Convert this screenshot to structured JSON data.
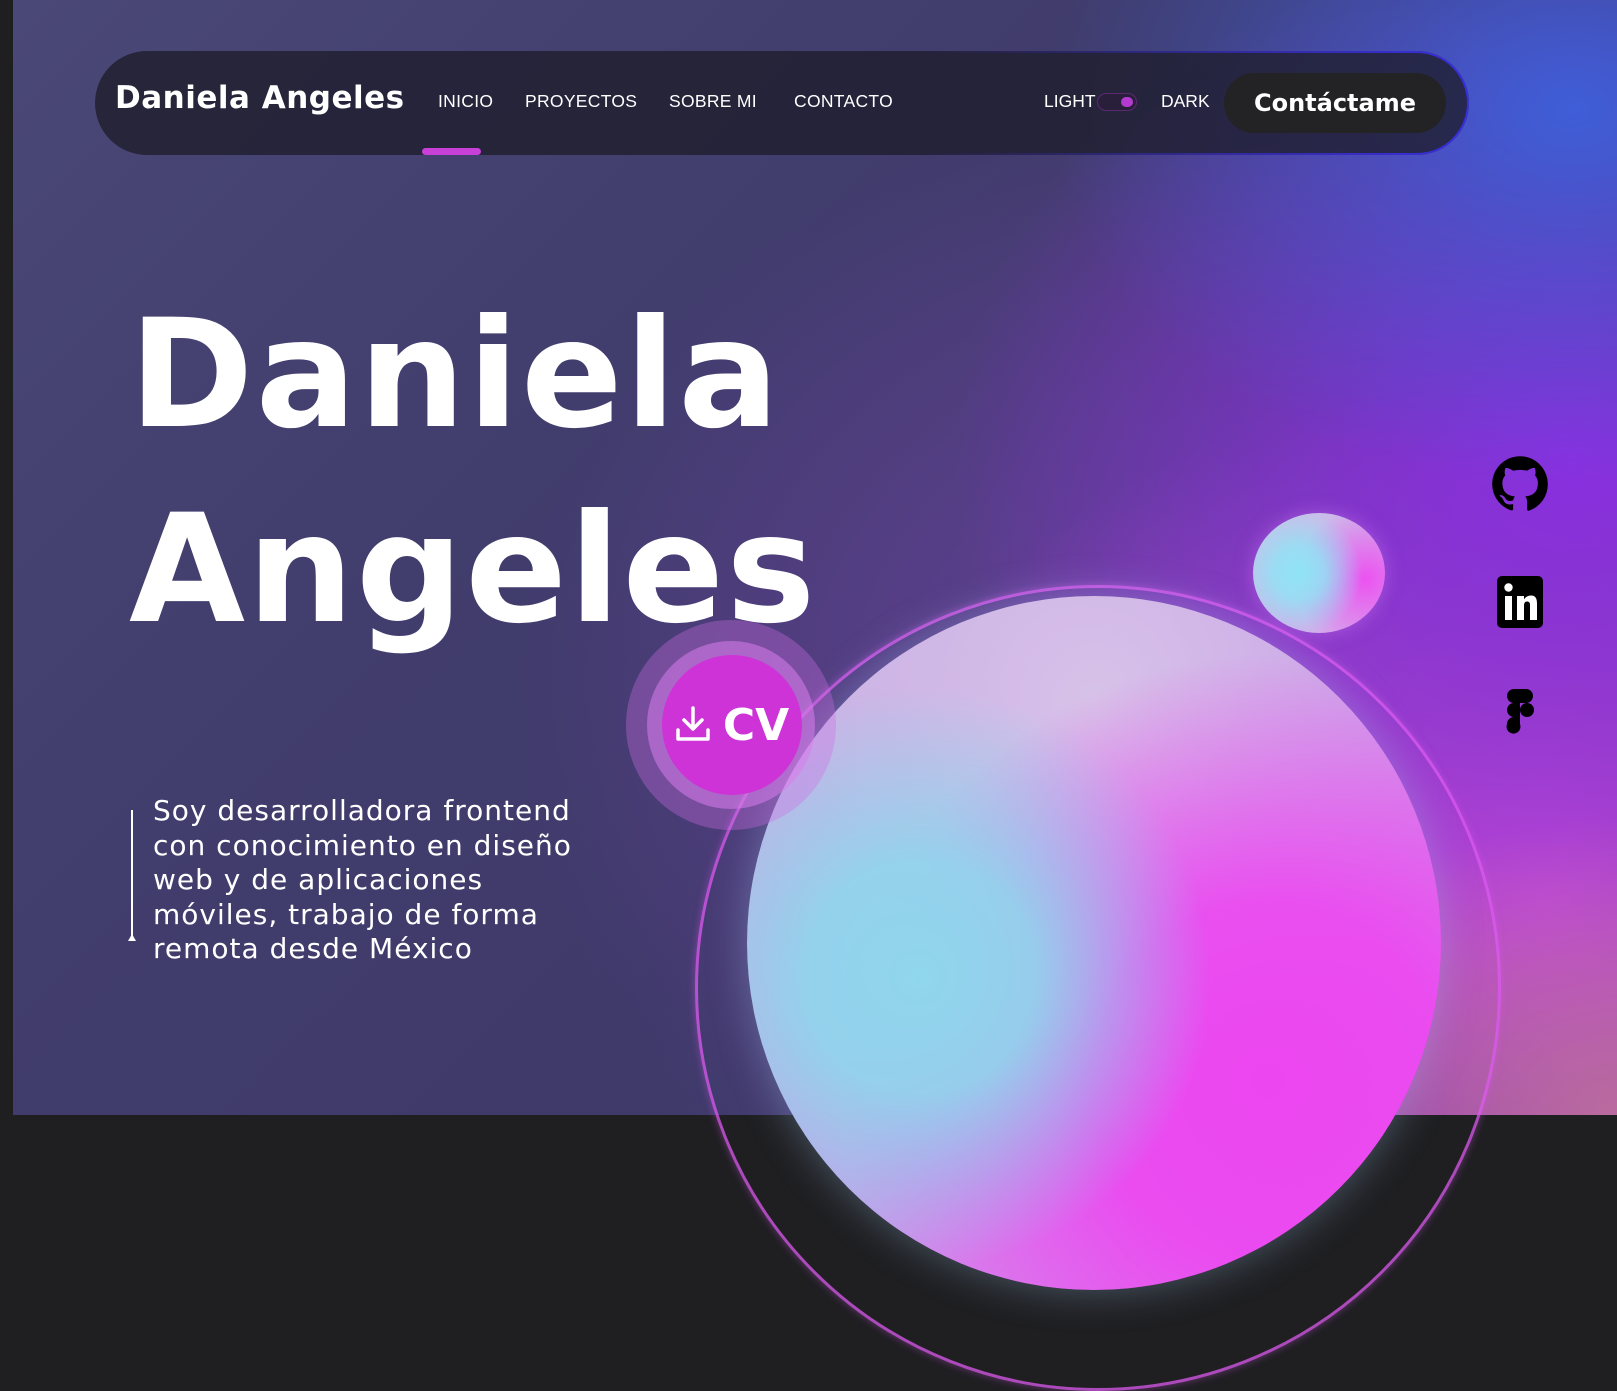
{
  "nav": {
    "brand": "Daniela Angeles",
    "links": [
      {
        "label": "INICIO",
        "active": true
      },
      {
        "label": "PROYECTOS",
        "active": false
      },
      {
        "label": "SOBRE MI",
        "active": false
      },
      {
        "label": "CONTACTO",
        "active": false
      }
    ],
    "theme_light_label": "LIGHT",
    "theme_dark_label": "DARK",
    "theme_selected": "DARK",
    "cta_label": "Contáctame"
  },
  "hero": {
    "name_line1": "Daniela",
    "name_line2": "Angeles",
    "cv_label": "CV",
    "cv_icon": "download-icon",
    "description": "Soy desarrolladora frontend con conocimiento en diseño web y de aplicaciones móviles, trabajo de forma remota desde México"
  },
  "social": [
    {
      "name": "github-icon"
    },
    {
      "name": "linkedin-icon"
    },
    {
      "name": "figma-icon"
    }
  ],
  "colors": {
    "accent": "#cd33d6",
    "nav_bg": "#1e1c2a",
    "cta_bg": "#232325"
  }
}
